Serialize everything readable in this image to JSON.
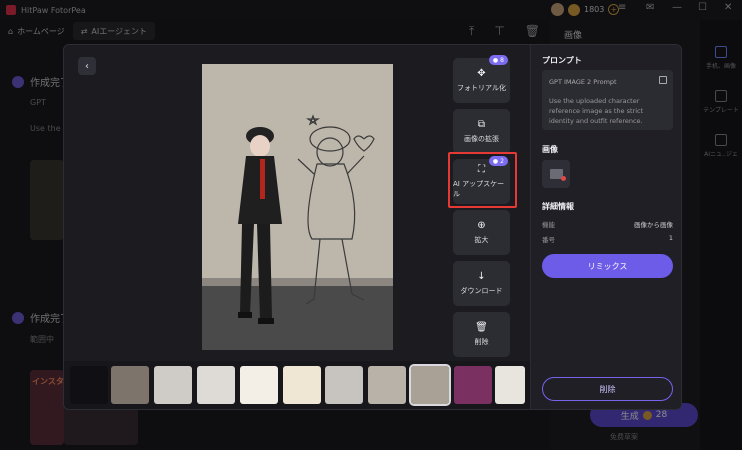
{
  "app": {
    "title": "HitPaw FotorPea",
    "credits": "1803"
  },
  "nav": {
    "home": "ホームページ",
    "ai_agent": "AIエージェント"
  },
  "background": {
    "section1_title": "作成完了",
    "section1_line1": "GPT",
    "section1_line2": "Use the",
    "section2_title": "作成完了",
    "section2_line1": "範囲中",
    "thumb_text": "インスタ"
  },
  "right_sidebar": {
    "header": "画像",
    "rail": [
      "手机、画像",
      "テンプレート",
      "AIニュ..ジェ"
    ],
    "generate_label": "生成",
    "generate_cost": "28",
    "free_note": "免费草案"
  },
  "modal": {
    "actions": [
      {
        "label": "フォトリアル化",
        "icon": "✥",
        "badge": "8"
      },
      {
        "label": "画像の拡張",
        "icon": "⧉",
        "badge": ""
      },
      {
        "label": "AI アップスケール",
        "icon": "⛶",
        "badge": "2"
      },
      {
        "label": "拡大",
        "icon": "⊕",
        "badge": ""
      },
      {
        "label": "ダウンロード",
        "icon": "↓",
        "badge": ""
      },
      {
        "label": "削除",
        "icon": "🗑",
        "badge": ""
      }
    ],
    "panel": {
      "prompt_heading": "プロンプト",
      "prompt_title": "GPT IMAGE 2 Prompt",
      "prompt_text": "Use the uploaded character reference image as the strict identity and outfit reference.",
      "image_heading": "画像",
      "details_heading": "詳細情報",
      "detail_rows": [
        {
          "key": "機能",
          "value": "画像から画像"
        },
        {
          "key": "番号",
          "value": "1"
        }
      ],
      "remix_label": "リミックス",
      "delete_label": "削除"
    },
    "thumbnail_count": 11,
    "selected_thumbnail": 8
  }
}
